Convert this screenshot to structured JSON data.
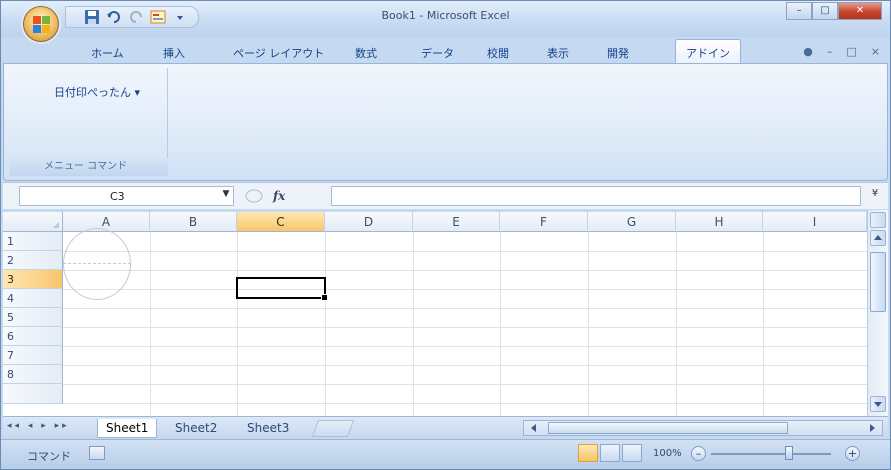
{
  "titlebar": {
    "title": "Book1 - Microsoft Excel",
    "minimize_glyph": "–",
    "maximize_glyph": "□",
    "close_glyph": "✕"
  },
  "ribbon": {
    "tabs": [
      {
        "label": "ホーム"
      },
      {
        "label": "挿入"
      },
      {
        "label": "ページ レイアウト"
      },
      {
        "label": "数式"
      },
      {
        "label": "データ"
      },
      {
        "label": "校閲"
      },
      {
        "label": "表示"
      },
      {
        "label": "開発"
      },
      {
        "label": "アドイン",
        "active": true
      }
    ],
    "help_glyph": "●",
    "min_glyph": "–",
    "restore_glyph": "□",
    "close_glyph": "×",
    "group": {
      "command": "日付印ぺったん ▾",
      "label": "メニュー コマンド"
    }
  },
  "formula_bar": {
    "name_box": "C3",
    "dropdown_glyph": "▼",
    "fx": "fx",
    "formula": "",
    "expand_glyph": "¥"
  },
  "grid": {
    "columns": [
      "A",
      "B",
      "C",
      "D",
      "E",
      "F",
      "G",
      "H",
      "I"
    ],
    "rows": [
      "1",
      "2",
      "3",
      "4",
      "5",
      "6",
      "7",
      "8"
    ],
    "active_cell": "C3"
  },
  "sheets": {
    "nav_glyphs": "◂◂ ◂ ▸ ▸▸",
    "tabs": [
      {
        "label": "Sheet1",
        "active": true
      },
      {
        "label": "Sheet2"
      },
      {
        "label": "Sheet3"
      }
    ]
  },
  "statusbar": {
    "mode": "コマンド",
    "zoom": "100%",
    "zoom_minus": "–",
    "zoom_plus": "+"
  },
  "colors": {
    "accent": "#f8c66d",
    "frame": "#c5d9f1"
  }
}
